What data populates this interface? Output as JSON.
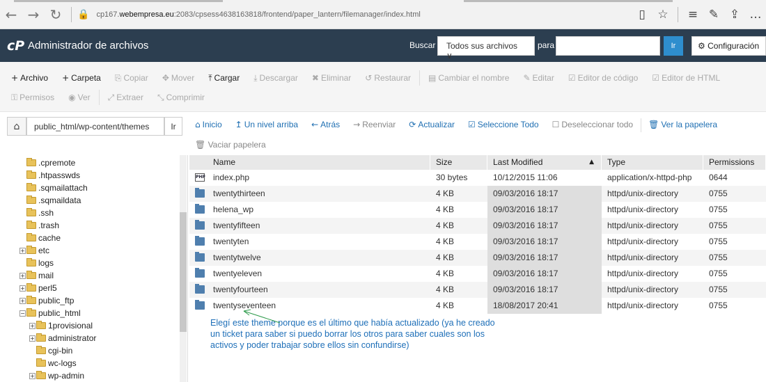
{
  "browser": {
    "url_prefix": "cp167.",
    "url_domain": "webempresa.eu",
    "url_rest": ":2083/cpsess4638163818/frontend/paper_lantern/filemanager/index.html"
  },
  "header": {
    "logo": "cP",
    "title": "Administrador de archivos",
    "search_label": "Buscar",
    "search_scope": "Todos sus archivos ∨",
    "para_label": "para",
    "search_value": "",
    "go_label": "Ir",
    "config_label": "Configuración"
  },
  "toolbar": {
    "row1": [
      {
        "icon": "+",
        "label": "Archivo",
        "enabled": true,
        "name": "new-file-button"
      },
      {
        "icon": "+",
        "label": "Carpeta",
        "enabled": true,
        "name": "new-folder-button"
      },
      {
        "icon": "⎘",
        "label": "Copiar",
        "enabled": false,
        "name": "copy-button"
      },
      {
        "icon": "✥",
        "label": "Mover",
        "enabled": false,
        "name": "move-button"
      },
      {
        "icon": "⤒",
        "label": "Cargar",
        "enabled": true,
        "name": "upload-button"
      },
      {
        "icon": "⤓",
        "label": "Descargar",
        "enabled": false,
        "name": "download-button"
      },
      {
        "icon": "✖",
        "label": "Eliminar",
        "enabled": false,
        "name": "delete-button"
      },
      {
        "icon": "↺",
        "label": "Restaurar",
        "enabled": false,
        "name": "restore-button"
      },
      {
        "icon": "▤",
        "label": "Cambiar el nombre",
        "enabled": false,
        "name": "rename-button"
      },
      {
        "icon": "✎",
        "label": "Editar",
        "enabled": false,
        "name": "edit-button"
      },
      {
        "icon": "☑",
        "label": "Editor de código",
        "enabled": false,
        "name": "code-editor-button"
      },
      {
        "icon": "☑",
        "label": "Editor de HTML",
        "enabled": false,
        "name": "html-editor-button"
      }
    ],
    "row2": [
      {
        "icon": "⚿",
        "label": "Permisos",
        "enabled": false,
        "name": "permissions-button"
      },
      {
        "icon": "◉",
        "label": "Ver",
        "enabled": false,
        "name": "view-button"
      },
      {
        "icon": "⤢",
        "label": "Extraer",
        "enabled": false,
        "name": "extract-button"
      },
      {
        "icon": "⤡",
        "label": "Comprimir",
        "enabled": false,
        "name": "compress-button"
      }
    ]
  },
  "pathbar": {
    "home_icon": "⌂",
    "path_value": "public_html/wp-content/themes",
    "go_label": "Ir",
    "links": [
      {
        "icon": "⌂",
        "label": "Inicio",
        "enabled": true,
        "name": "home-link"
      },
      {
        "icon": "↥",
        "label": "Un nivel arriba",
        "enabled": true,
        "name": "up-one-level-link"
      },
      {
        "icon": "←",
        "label": "Atrás",
        "enabled": true,
        "name": "back-link"
      },
      {
        "icon": "→",
        "label": "Reenviar",
        "enabled": false,
        "name": "forward-link"
      },
      {
        "icon": "⟳",
        "label": "Actualizar",
        "enabled": true,
        "name": "reload-link"
      },
      {
        "icon": "☑",
        "label": "Seleccione Todo",
        "enabled": true,
        "name": "select-all-link"
      },
      {
        "icon": "☐",
        "label": "Deseleccionar todo",
        "enabled": false,
        "name": "unselect-all-link"
      },
      {
        "icon": "🗑",
        "label": "Ver la papelera",
        "enabled": true,
        "name": "view-trash-link"
      }
    ],
    "empty_trash": "🗑 Vaciar papelera"
  },
  "tree": [
    {
      "label": ".cpremote",
      "expander": "",
      "depth": 0
    },
    {
      "label": ".htpasswds",
      "expander": "",
      "depth": 0
    },
    {
      "label": ".sqmailattach",
      "expander": "",
      "depth": 0
    },
    {
      "label": ".sqmaildata",
      "expander": "",
      "depth": 0
    },
    {
      "label": ".ssh",
      "expander": "",
      "depth": 0
    },
    {
      "label": ".trash",
      "expander": "",
      "depth": 0
    },
    {
      "label": "cache",
      "expander": "",
      "depth": 0
    },
    {
      "label": "etc",
      "expander": "+",
      "depth": 0
    },
    {
      "label": "logs",
      "expander": "",
      "depth": 0
    },
    {
      "label": "mail",
      "expander": "+",
      "depth": 0
    },
    {
      "label": "perl5",
      "expander": "+",
      "depth": 0
    },
    {
      "label": "public_ftp",
      "expander": "+",
      "depth": 0
    },
    {
      "label": "public_html",
      "expander": "−",
      "depth": 0
    },
    {
      "label": "1provisional",
      "expander": "+",
      "depth": 1
    },
    {
      "label": "administrator",
      "expander": "+",
      "depth": 1
    },
    {
      "label": "cgi-bin",
      "expander": "",
      "depth": 1
    },
    {
      "label": "wc-logs",
      "expander": "",
      "depth": 1
    },
    {
      "label": "wp-admin",
      "expander": "+",
      "depth": 1
    }
  ],
  "table": {
    "headers": [
      "Name",
      "Size",
      "Last Modified",
      "Type",
      "Permissions"
    ],
    "sort_indicator": "▲",
    "rows": [
      {
        "icon": "php",
        "name": "index.php",
        "size": "30 bytes",
        "modified": "10/12/2015 11:06",
        "type": "application/x-httpd-php",
        "perms": "0644"
      },
      {
        "icon": "dir",
        "name": "twentythirteen",
        "size": "4 KB",
        "modified": "09/03/2016 18:17",
        "type": "httpd/unix-directory",
        "perms": "0755"
      },
      {
        "icon": "dir",
        "name": "helena_wp",
        "size": "4 KB",
        "modified": "09/03/2016 18:17",
        "type": "httpd/unix-directory",
        "perms": "0755"
      },
      {
        "icon": "dir",
        "name": "twentyfifteen",
        "size": "4 KB",
        "modified": "09/03/2016 18:17",
        "type": "httpd/unix-directory",
        "perms": "0755"
      },
      {
        "icon": "dir",
        "name": "twentyten",
        "size": "4 KB",
        "modified": "09/03/2016 18:17",
        "type": "httpd/unix-directory",
        "perms": "0755"
      },
      {
        "icon": "dir",
        "name": "twentytwelve",
        "size": "4 KB",
        "modified": "09/03/2016 18:17",
        "type": "httpd/unix-directory",
        "perms": "0755"
      },
      {
        "icon": "dir",
        "name": "twentyeleven",
        "size": "4 KB",
        "modified": "09/03/2016 18:17",
        "type": "httpd/unix-directory",
        "perms": "0755"
      },
      {
        "icon": "dir",
        "name": "twentyfourteen",
        "size": "4 KB",
        "modified": "09/03/2016 18:17",
        "type": "httpd/unix-directory",
        "perms": "0755"
      },
      {
        "icon": "dir",
        "name": "twentyseventeen",
        "size": "4 KB",
        "modified": "18/08/2017 20:41",
        "type": "httpd/unix-directory",
        "perms": "0755"
      }
    ]
  },
  "annotation": "Elegí este theme porque es el último que había actualizado (ya he creado un ticket para saber si puedo borrar los otros para saber cuales son los activos y poder trabajar sobre ellos sin confundirse)"
}
